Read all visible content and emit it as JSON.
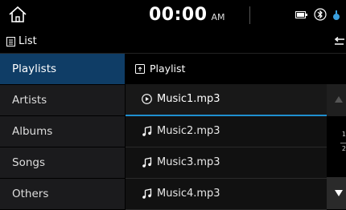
{
  "status": {
    "time": "00:00",
    "ampm": "AM"
  },
  "header": {
    "title": "List"
  },
  "sidebar": {
    "items": [
      {
        "label": "Playlists",
        "active": true
      },
      {
        "label": "Artists"
      },
      {
        "label": "Albums"
      },
      {
        "label": "Songs"
      },
      {
        "label": "Others"
      }
    ]
  },
  "main": {
    "breadcrumb": "Playlist",
    "tracks": [
      {
        "title": "Music1.mp3",
        "icon": "play-circle-icon",
        "playing": true
      },
      {
        "title": "Music2.mp3",
        "icon": "music-note-icon"
      },
      {
        "title": "Music3.mp3",
        "icon": "music-note-icon"
      },
      {
        "title": "Music4.mp3",
        "icon": "music-note-icon"
      }
    ]
  },
  "pager": {
    "current": "1",
    "total": "2"
  },
  "colors": {
    "active_item": "#0f3d66",
    "accent": "#1f8fd0",
    "sidebar_bg": "#1b1b1d"
  }
}
